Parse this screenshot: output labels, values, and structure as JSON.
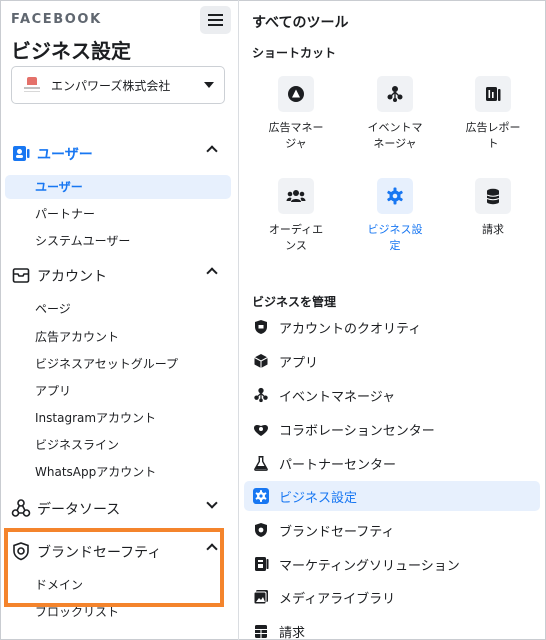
{
  "sidebar": {
    "brand": "FACEBOOK",
    "title": "ビジネス設定",
    "account": {
      "name": "エンパワーズ株式会社"
    },
    "sections": [
      {
        "label": "ユーザー",
        "icon": "users-badge-icon",
        "expanded": true,
        "items": [
          "ユーザー",
          "パートナー",
          "システムユーザー"
        ]
      },
      {
        "label": "アカウント",
        "icon": "inbox-icon",
        "expanded": true,
        "items": [
          "ページ",
          "広告アカウント",
          "ビジネスアセットグループ",
          "アプリ",
          "Instagramアカウント",
          "ビジネスライン",
          "WhatsAppアカウント"
        ]
      },
      {
        "label": "データソース",
        "icon": "data-sources-icon",
        "expanded": false,
        "items": []
      },
      {
        "label": "ブランドセーフティ",
        "icon": "shield-icon",
        "expanded": true,
        "items": [
          "ドメイン",
          "ブロックリスト"
        ]
      }
    ]
  },
  "tools": {
    "title": "すべてのツール",
    "shortcuts_label": "ショートカット",
    "shortcuts": [
      {
        "label": "広告マネー\nジャ",
        "icon": "ads-manager-icon"
      },
      {
        "label": "イベントマ\nネージャ",
        "icon": "events-manager-icon"
      },
      {
        "label": "広告レポー\nト",
        "icon": "ads-reporting-icon"
      },
      {
        "label": "オーディエ\nンス",
        "icon": "audiences-icon"
      },
      {
        "label": "ビジネス設\n定",
        "icon": "gear-icon",
        "active": true
      },
      {
        "label": "請求",
        "icon": "billing-icon"
      }
    ],
    "manage_label": "ビジネスを管理",
    "manage_items": [
      {
        "label": "アカウントのクオリティ",
        "icon": "account-quality-icon"
      },
      {
        "label": "アプリ",
        "icon": "app-cube-icon"
      },
      {
        "label": "イベントマネージャ",
        "icon": "events-manager-icon"
      },
      {
        "label": "コラボレーションセンター",
        "icon": "collaboration-icon"
      },
      {
        "label": "パートナーセンター",
        "icon": "flask-icon"
      },
      {
        "label": "ビジネス設定",
        "icon": "gear-icon",
        "active": true
      },
      {
        "label": "ブランドセーフティ",
        "icon": "shield-icon"
      },
      {
        "label": "マーケティングソリューション",
        "icon": "marketing-solutions-icon"
      },
      {
        "label": "メディアライブラリ",
        "icon": "media-library-icon"
      },
      {
        "label": "請求",
        "icon": "billing-icon"
      }
    ]
  },
  "colors": {
    "accent": "#1877f2",
    "active_bg": "#e7f0fd",
    "highlight": "#f4842c",
    "icon_bg": "#f0f2f5"
  }
}
